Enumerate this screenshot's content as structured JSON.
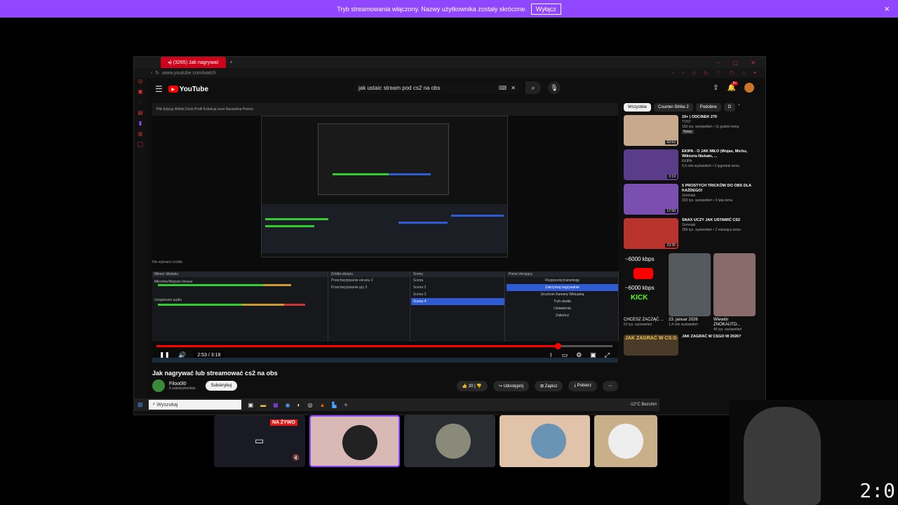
{
  "banner": {
    "text": "Tryb streamowania włączony. Nazwy użytkownika zostały skrócone.",
    "button": "Wyłącz",
    "close": "×"
  },
  "browser": {
    "tab_label": "(3265) Jak nagrywać",
    "url": "www.youtube.com/watch"
  },
  "youtube": {
    "logo": "YouTube",
    "country": "PL",
    "search_query": "jak ustaic stream pod cs2 na obs",
    "notif_count": "9+"
  },
  "obs": {
    "menu": "Plik  Edycja  Widok  Dock  Profil  Kolekcja scen  Narzędzia  Pomoc",
    "no_source": "Nie wybrano źródła",
    "dock_titles": [
      "Mikser dźwięku",
      "Źródła obrazu",
      "Sceny",
      "Panel sterujący"
    ],
    "mixer_items": [
      "Mikrofon/Wejście liniowe",
      "Urządzenie audio"
    ],
    "sources": [
      "Przechwytywanie ekranu 2",
      "Przechwytywanie gry 3"
    ],
    "scenes": [
      "Scena",
      "Scena 2",
      "Scena 3",
      "Scena 4"
    ],
    "controls": [
      "Rozpocznij transmisję",
      "Zatrzymaj nagrywanie",
      "Uruchom Kamerę Wirtualną",
      "Tryb studia",
      "Ustawienia",
      "Zakończ"
    ]
  },
  "player": {
    "time": "2:53 / 3:18",
    "progress_fraction": 0.88
  },
  "video": {
    "title": "Jak nagrywać lub streamować cs2 na obs",
    "channel": "Filoo0l0",
    "subs": "6 subskrybentów",
    "subscribe": "Subskrybuj",
    "likes": "20",
    "share": "Udostępnij",
    "save": "Zapisz",
    "download": "Pobierz"
  },
  "chips": [
    "Wszystkie",
    "Counter-Strike 2",
    "Podobne",
    "D"
  ],
  "recs": [
    {
      "title": "19+ | ODCINEK 270",
      "meta1": "TVN7",
      "meta2": "150 tys. wyświetleń • 11 godzin temu",
      "badge": "Nowy",
      "duration": "52:52",
      "color": "#c9a98e"
    },
    {
      "title": "EKIPA - O JAK MIŁO (Wujas, Michu, Wiktoria Niekało, ...",
      "meta1": "EKIPA",
      "meta2": "5,5 mln wyświetleń • 2 tygodnie temu",
      "badge": "",
      "duration": "3:19",
      "color": "#5b3c8a"
    },
    {
      "title": "5 PROSTYCH TRICKÓW DO OBS DLA KAŻDEGO!",
      "meta1": "Zemniak",
      "meta2": "203 tys. wyświetleń • 3 lata temu",
      "badge": "",
      "duration": "17:50",
      "color": "#7b4fb0"
    },
    {
      "title": "SNAX UCZY JAK USTAWIĆ CS2",
      "meta1": "Zemniak",
      "meta2": "359 tys. wyświetleń • 2 miesiące temu",
      "badge": "",
      "duration": "23:35",
      "color": "#b8332b"
    }
  ],
  "shorts": [
    {
      "cap": "CHCESZ ZACZĄĆ ...",
      "meta": "52 tys. wyświetleń",
      "top": "~6000 kbps",
      "mid": "~6000 kbps",
      "bot": "KICK",
      "color": "#111"
    },
    {
      "cap": "23. januar 2026",
      "meta": "1,4 mln wyświetleń",
      "top": "",
      "mid": "",
      "bot": "",
      "color": "#555a5e"
    },
    {
      "cap": "Wiewiór ZNOKAUTO...",
      "meta": "46 tys. wyświetleń",
      "top": "",
      "mid": "",
      "bot": "",
      "color": "#8a6b6b"
    }
  ],
  "last_rec": {
    "title": "JAK ZAGRAĆ W CSGO W 2026?",
    "thumb_text": "JAK ZAGRAĆ W CS:G"
  },
  "taskbar": {
    "search": "Wyszukaj",
    "weather": "-12°C  Bezchm"
  },
  "stream_thumbs": {
    "live": "NA ŻYWO"
  },
  "clock": "2:0"
}
